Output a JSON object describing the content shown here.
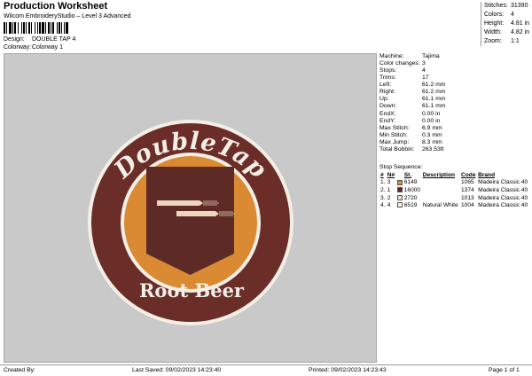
{
  "header": {
    "title": "Production Worksheet",
    "subtitle": "Wilcom EmbroideryStudio – Level 3 Advanced",
    "design_label": "Design:",
    "design_value": "DOUBLE TAP 4",
    "colorway_label": "Colorway:",
    "colorway_value": "Colorway 1"
  },
  "stats": [
    {
      "label": "Stitches:",
      "value": "31390"
    },
    {
      "label": "Colors:",
      "value": "4"
    },
    {
      "label": "Height:",
      "value": "4.81 in"
    },
    {
      "label": "Width:",
      "value": "4.82 in"
    },
    {
      "label": "Zoom:",
      "value": "1:1"
    }
  ],
  "details": [
    {
      "label": "Machine:",
      "value": "Tajima"
    },
    {
      "label": "Color changes:",
      "value": "3"
    },
    {
      "label": "Stops:",
      "value": "4"
    },
    {
      "label": "Trims:",
      "value": "17"
    },
    {
      "label": "Left:",
      "value": "61.2 mm"
    },
    {
      "label": "Right:",
      "value": "61.2 mm"
    },
    {
      "label": "Up:",
      "value": "61.1 mm"
    },
    {
      "label": "Down:",
      "value": "61.1 mm"
    },
    {
      "label": "EndX:",
      "value": "0.00 in"
    },
    {
      "label": "EndY:",
      "value": "0.00 in"
    },
    {
      "label": "Max Stitch:",
      "value": "6.9 mm"
    },
    {
      "label": "Min Stitch:",
      "value": "0.3 mm"
    },
    {
      "label": "Max Jump:",
      "value": "8.3 mm"
    },
    {
      "label": "Total Bobbin:",
      "value": "263.53ft"
    }
  ],
  "stop_sequence": {
    "title": "Stop Sequence:",
    "columns": [
      "#",
      "N#",
      "",
      "St.",
      "Description",
      "Code",
      "Brand"
    ],
    "rows": [
      {
        "num": "1.",
        "n": "3",
        "color": "#e08a2e",
        "st": "6149",
        "desc": "",
        "code": "1065",
        "brand": "Madeira Classic 40"
      },
      {
        "num": "2.",
        "n": "1",
        "color": "#5a2420",
        "st": "16000",
        "desc": "",
        "code": "1374",
        "brand": "Madeira Classic 40"
      },
      {
        "num": "3.",
        "n": "2",
        "color": "#f2dcc4",
        "st": "2720",
        "desc": "",
        "code": "1013",
        "brand": "Madeira Classic 40"
      },
      {
        "num": "4.",
        "n": "4",
        "color": "#f4f3ee",
        "st": "6519",
        "desc": "Natural White",
        "code": "1004",
        "brand": "Madeira Classic 40"
      }
    ]
  },
  "design": {
    "top_text": "DoubleTap",
    "bottom_text": "Root Beer",
    "colors": {
      "ring": "#6b2d28",
      "inner": "#d98a33",
      "shield": "#5e2a26",
      "border": "#f3efe6",
      "bullet": "#ecd6bd"
    }
  },
  "footer": {
    "created_by": "Created By:",
    "last_saved": "Last Saved: 09/02/2023 14:23:40",
    "printed": "Printed: 09/02/2023 14:23:43",
    "page": "Page 1 of 1"
  }
}
